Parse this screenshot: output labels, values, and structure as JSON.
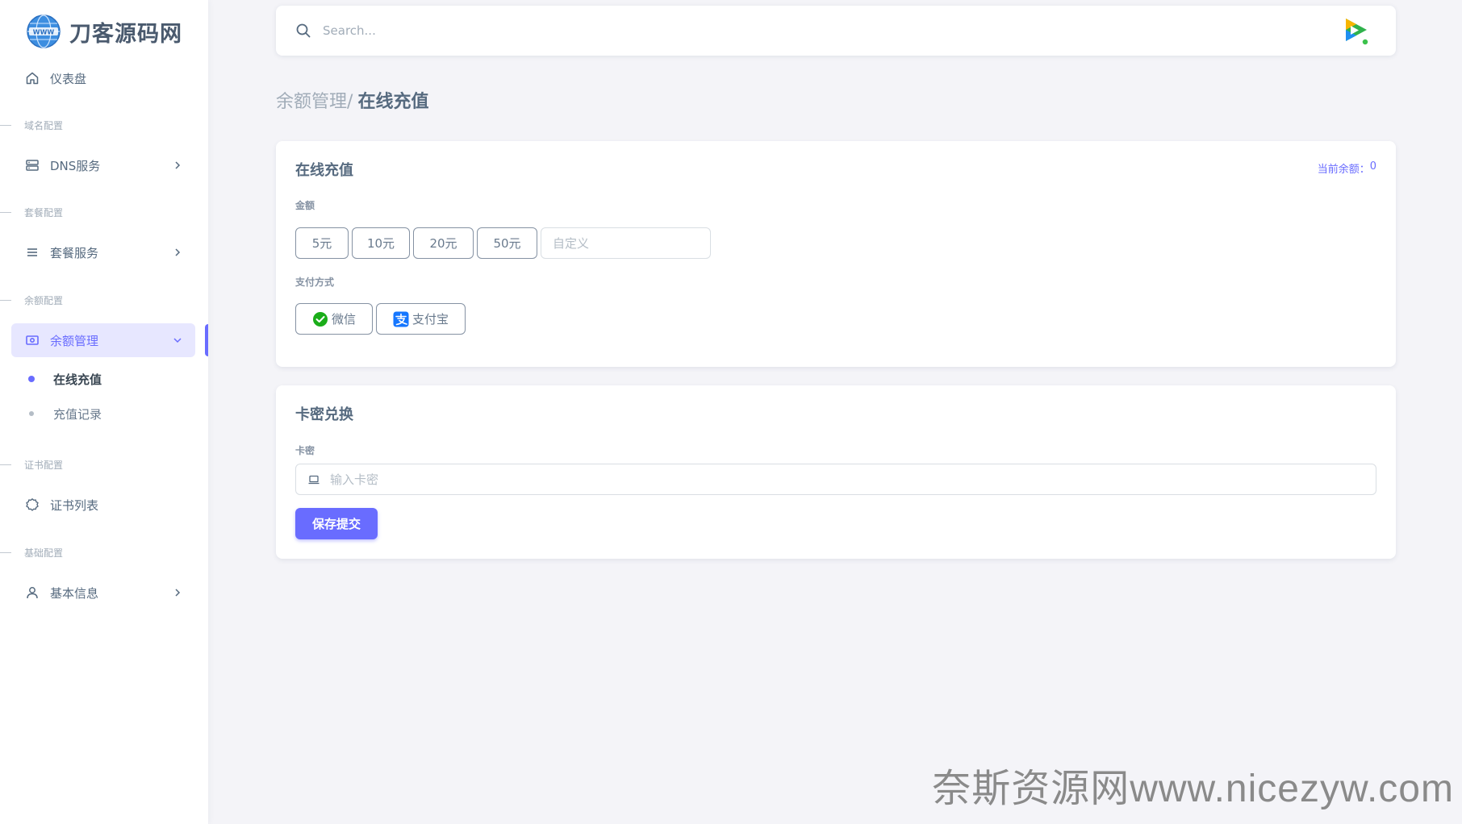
{
  "brand": {
    "name": "刀客源码网",
    "logo_icon": "globe-www-icon"
  },
  "sidebar": {
    "dashboard": {
      "label": "仪表盘",
      "icon": "home-icon"
    },
    "sections": [
      {
        "header": "域名配置",
        "item": {
          "label": "DNS服务",
          "icon": "server-icon",
          "has_submenu": true
        }
      },
      {
        "header": "套餐配置",
        "item": {
          "label": "套餐服务",
          "icon": "menu-icon",
          "has_submenu": true
        }
      },
      {
        "header": "余额配置",
        "item": {
          "label": "余额管理",
          "icon": "wallet-icon",
          "has_submenu": true,
          "expanded": true
        }
      },
      {
        "header": "证书配置",
        "item": {
          "label": "证书列表",
          "icon": "certificate-icon",
          "has_submenu": false
        }
      },
      {
        "header": "基础配置",
        "item": {
          "label": "基本信息",
          "icon": "user-icon",
          "has_submenu": true
        }
      }
    ],
    "balance_submenu": [
      {
        "label": "在线充值",
        "active": true
      },
      {
        "label": "充值记录",
        "active": false
      }
    ]
  },
  "navbar": {
    "search_placeholder": "Search...",
    "avatar_icon": "video-play-avatar-icon"
  },
  "breadcrumb": {
    "parent": "余额管理",
    "separator": "/",
    "current": "在线充值"
  },
  "recharge_card": {
    "title": "在线充值",
    "balance_label": "当前余额：",
    "balance_value": "0",
    "amount_label": "金额",
    "amount_options": [
      "5元",
      "10元",
      "20元",
      "50元"
    ],
    "custom_placeholder": "自定义",
    "payment_label": "支付方式",
    "payment_methods": [
      {
        "label": "微信",
        "icon": "wechat-icon",
        "color": "#1aad19"
      },
      {
        "label": "支付宝",
        "icon": "alipay-icon",
        "color": "#1677ff"
      }
    ]
  },
  "redeem_card": {
    "title": "卡密兑换",
    "field_label": "卡密",
    "placeholder": "输入卡密",
    "submit_label": "保存提交"
  },
  "watermark": "奈斯资源网www.nicezyw.com",
  "colors": {
    "accent": "#696cff",
    "accent_light": "#e7e7ff",
    "text": "#566a7f",
    "muted": "#a1acb8"
  }
}
